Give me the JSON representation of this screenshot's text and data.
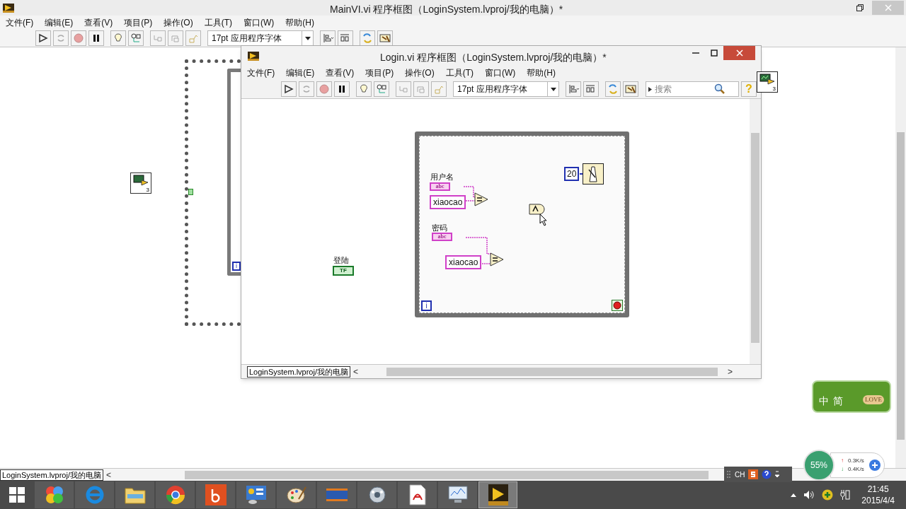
{
  "main_window": {
    "title": "MainVI.vi 程序框图（LoginSystem.lvproj/我的电脑）*",
    "menu": [
      "文件(F)",
      "编辑(E)",
      "查看(V)",
      "项目(P)",
      "操作(O)",
      "工具(T)",
      "窗口(W)",
      "帮助(H)"
    ],
    "font_select": "17pt 应用程序字体",
    "vi_icon_badge": "3",
    "loop_index": "i",
    "path": "LoginSystem.lvproj/我的电脑",
    "scroll_left": "<"
  },
  "login_window": {
    "title": "Login.vi 程序框图（LoginSystem.lvproj/我的电脑）*",
    "menu": [
      "文件(F)",
      "编辑(E)",
      "查看(V)",
      "项目(P)",
      "操作(O)",
      "工具(T)",
      "窗口(W)",
      "帮助(H)"
    ],
    "font_select": "17pt 应用程序字体",
    "search": {
      "placeholder": "搜索"
    },
    "help": "?",
    "vi_icon_badge": "3",
    "path": "LoginSystem.lvproj/我的电脑",
    "scroll_left": "<",
    "scroll_right": ">",
    "diagram": {
      "controls": [
        {
          "label": "用户名",
          "terminal": "abc",
          "constant": "xiaocao"
        },
        {
          "label": "密码",
          "terminal": "abc",
          "constant": "xiaocao"
        }
      ],
      "wait_ms": "20",
      "button": {
        "label": "登陆",
        "terminal": "TF"
      },
      "loop_index": "i"
    }
  },
  "ime_skin": {
    "chars": [
      "中",
      "简"
    ],
    "badge": "LOVE"
  },
  "net_meter": {
    "percent": "55%",
    "up_arrow": "↑",
    "up": "0.3K/s",
    "down_arrow": "↓",
    "down": "0.4K/s"
  },
  "ime_bar": {
    "lang": "CH"
  },
  "taskbar": {
    "apps": [
      {
        "kind": "colorful",
        "selected": false
      },
      {
        "kind": "ie",
        "selected": false
      },
      {
        "kind": "folder",
        "selected": false
      },
      {
        "kind": "chrome",
        "selected": false
      },
      {
        "kind": "bing",
        "selected": false
      },
      {
        "kind": "panel",
        "selected": false
      },
      {
        "kind": "paint",
        "selected": false
      },
      {
        "kind": "jm",
        "selected": false
      },
      {
        "kind": "media",
        "selected": false
      },
      {
        "kind": "pdf",
        "selected": false
      },
      {
        "kind": "monitor",
        "selected": false
      },
      {
        "kind": "labview",
        "selected": true
      }
    ],
    "time": "21:45",
    "date": "2015/4/4"
  }
}
